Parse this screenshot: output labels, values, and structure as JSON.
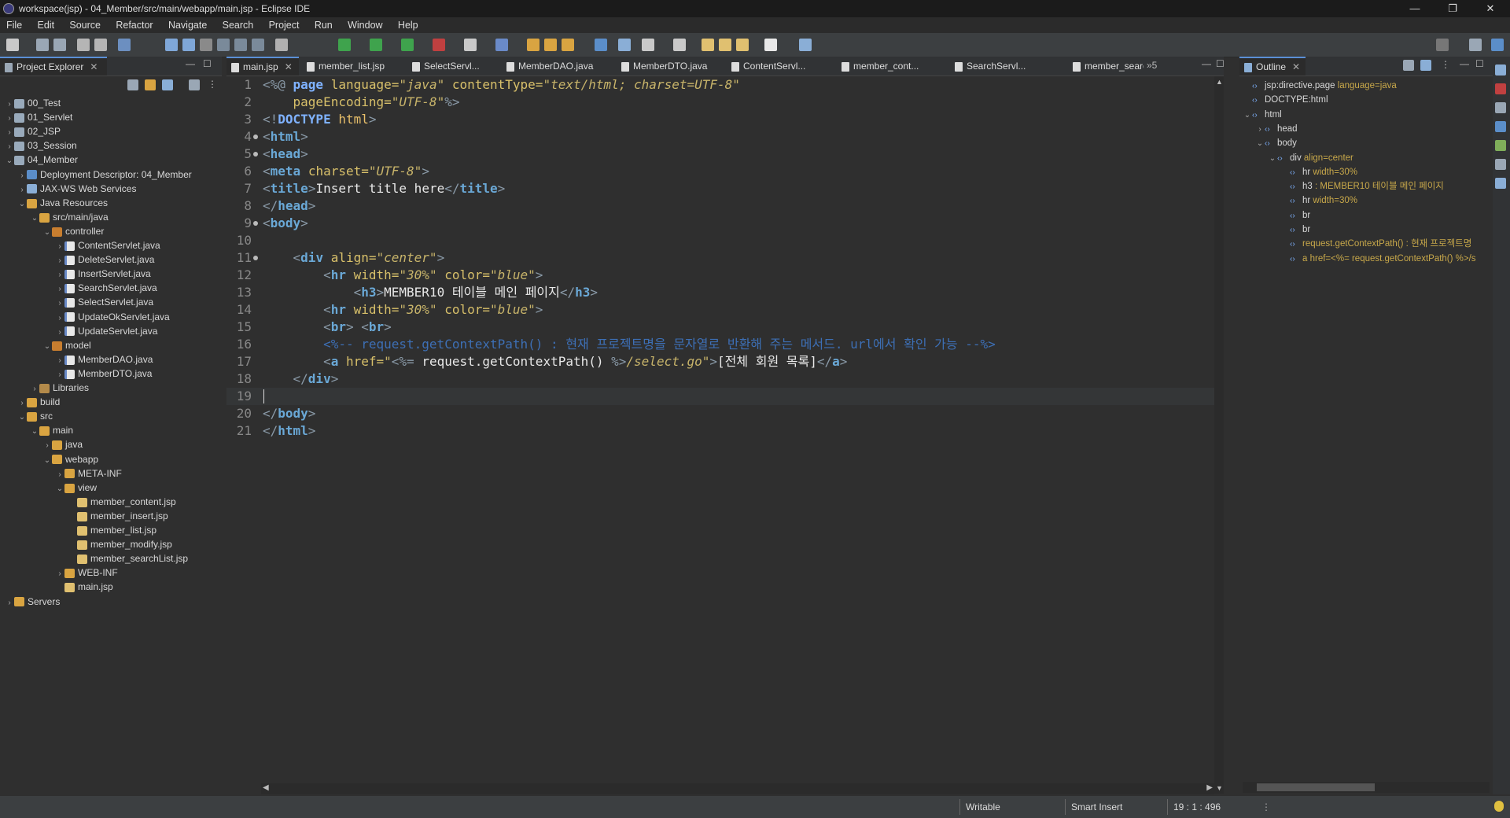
{
  "window": {
    "title": "workspace(jsp) - 04_Member/src/main/webapp/main.jsp - Eclipse IDE",
    "minimize": "—",
    "maximize": "❐",
    "close": "✕"
  },
  "menu": [
    "File",
    "Edit",
    "Source",
    "Refactor",
    "Navigate",
    "Search",
    "Project",
    "Run",
    "Window",
    "Help"
  ],
  "project_explorer": {
    "tab_label": "Project Explorer",
    "tree": [
      {
        "label": "00_Test",
        "indent": 0,
        "icon": "proj",
        "twisty": ">"
      },
      {
        "label": "01_Servlet",
        "indent": 0,
        "icon": "proj",
        "twisty": ">"
      },
      {
        "label": "02_JSP",
        "indent": 0,
        "icon": "proj",
        "twisty": ">"
      },
      {
        "label": "03_Session",
        "indent": 0,
        "icon": "proj",
        "twisty": ">"
      },
      {
        "label": "04_Member",
        "indent": 0,
        "icon": "proj",
        "twisty": "v"
      },
      {
        "label": "Deployment Descriptor: 04_Member",
        "indent": 1,
        "icon": "dd",
        "twisty": ">"
      },
      {
        "label": "JAX-WS Web Services",
        "indent": 1,
        "icon": "ws",
        "twisty": ">"
      },
      {
        "label": "Java Resources",
        "indent": 1,
        "icon": "folder",
        "twisty": "v"
      },
      {
        "label": "src/main/java",
        "indent": 2,
        "icon": "folder",
        "twisty": "v"
      },
      {
        "label": "controller",
        "indent": 3,
        "icon": "pkg",
        "twisty": "v"
      },
      {
        "label": "ContentServlet.java",
        "indent": 4,
        "icon": "java",
        "twisty": ">"
      },
      {
        "label": "DeleteServlet.java",
        "indent": 4,
        "icon": "java",
        "twisty": ">"
      },
      {
        "label": "InsertServlet.java",
        "indent": 4,
        "icon": "java",
        "twisty": ">"
      },
      {
        "label": "SearchServlet.java",
        "indent": 4,
        "icon": "java",
        "twisty": ">"
      },
      {
        "label": "SelectServlet.java",
        "indent": 4,
        "icon": "java",
        "twisty": ">"
      },
      {
        "label": "UpdateOkServlet.java",
        "indent": 4,
        "icon": "java",
        "twisty": ">"
      },
      {
        "label": "UpdateServlet.java",
        "indent": 4,
        "icon": "java",
        "twisty": ">"
      },
      {
        "label": "model",
        "indent": 3,
        "icon": "pkg",
        "twisty": "v"
      },
      {
        "label": "MemberDAO.java",
        "indent": 4,
        "icon": "java",
        "twisty": ">"
      },
      {
        "label": "MemberDTO.java",
        "indent": 4,
        "icon": "java",
        "twisty": ">"
      },
      {
        "label": "Libraries",
        "indent": 2,
        "icon": "lib",
        "twisty": ">"
      },
      {
        "label": "build",
        "indent": 1,
        "icon": "folder",
        "twisty": ">"
      },
      {
        "label": "src",
        "indent": 1,
        "icon": "folder",
        "twisty": "v"
      },
      {
        "label": "main",
        "indent": 2,
        "icon": "folder",
        "twisty": "v"
      },
      {
        "label": "java",
        "indent": 3,
        "icon": "folder",
        "twisty": ">"
      },
      {
        "label": "webapp",
        "indent": 3,
        "icon": "folder",
        "twisty": "v"
      },
      {
        "label": "META-INF",
        "indent": 4,
        "icon": "folder",
        "twisty": ">"
      },
      {
        "label": "view",
        "indent": 4,
        "icon": "folder",
        "twisty": "v"
      },
      {
        "label": "member_content.jsp",
        "indent": 5,
        "icon": "jsp",
        "twisty": ""
      },
      {
        "label": "member_insert.jsp",
        "indent": 5,
        "icon": "jsp",
        "twisty": ""
      },
      {
        "label": "member_list.jsp",
        "indent": 5,
        "icon": "jsp",
        "twisty": ""
      },
      {
        "label": "member_modify.jsp",
        "indent": 5,
        "icon": "jsp",
        "twisty": ""
      },
      {
        "label": "member_searchList.jsp",
        "indent": 5,
        "icon": "jsp",
        "twisty": ""
      },
      {
        "label": "WEB-INF",
        "indent": 4,
        "icon": "folder",
        "twisty": ">"
      },
      {
        "label": "main.jsp",
        "indent": 4,
        "icon": "jsp",
        "twisty": ""
      },
      {
        "label": "Servers",
        "indent": 0,
        "icon": "folder",
        "twisty": ">"
      }
    ]
  },
  "editor_tabs": [
    {
      "label": "main.jsp",
      "active": true
    },
    {
      "label": "member_list.jsp",
      "active": false
    },
    {
      "label": "SelectServl...",
      "active": false
    },
    {
      "label": "MemberDAO.java",
      "active": false
    },
    {
      "label": "MemberDTO.java",
      "active": false
    },
    {
      "label": "ContentServl...",
      "active": false
    },
    {
      "label": "member_cont...",
      "active": false
    },
    {
      "label": "SearchServl...",
      "active": false
    },
    {
      "label": "member_searc...",
      "active": false
    }
  ],
  "more_tabs": "»5",
  "code_lines": [
    [
      [
        "k-br",
        "<%@ "
      ],
      [
        "k-kw",
        "page "
      ],
      [
        "k-attr",
        "language="
      ],
      [
        "k-str",
        "\"java\" "
      ],
      [
        "k-attr",
        "contentType="
      ],
      [
        "k-str",
        "\"text/html; charset=UTF-8\""
      ]
    ],
    [
      [
        "k-txt",
        "    "
      ],
      [
        "k-attr",
        "pageEncoding="
      ],
      [
        "k-str",
        "\"UTF-8\""
      ],
      [
        "k-br",
        "%>"
      ]
    ],
    [
      [
        "k-br",
        "<!"
      ],
      [
        "k-kw",
        "DOCTYPE "
      ],
      [
        "k-dir",
        "html"
      ],
      [
        "k-br",
        ">"
      ]
    ],
    [
      [
        "k-br",
        "<"
      ],
      [
        "k-tag",
        "html"
      ],
      [
        "k-br",
        ">"
      ]
    ],
    [
      [
        "k-br",
        "<"
      ],
      [
        "k-tag",
        "head"
      ],
      [
        "k-br",
        ">"
      ]
    ],
    [
      [
        "k-br",
        "<"
      ],
      [
        "k-tag",
        "meta "
      ],
      [
        "k-attr",
        "charset="
      ],
      [
        "k-str",
        "\"UTF-8\""
      ],
      [
        "k-br",
        ">"
      ]
    ],
    [
      [
        "k-br",
        "<"
      ],
      [
        "k-tag",
        "title"
      ],
      [
        "k-br",
        ">"
      ],
      [
        "k-txt",
        "Insert title here"
      ],
      [
        "k-br",
        "</"
      ],
      [
        "k-tag",
        "title"
      ],
      [
        "k-br",
        ">"
      ]
    ],
    [
      [
        "k-br",
        "</"
      ],
      [
        "k-tag",
        "head"
      ],
      [
        "k-br",
        ">"
      ]
    ],
    [
      [
        "k-br",
        "<"
      ],
      [
        "k-tag",
        "body"
      ],
      [
        "k-br",
        ">"
      ]
    ],
    [],
    [
      [
        "k-txt",
        "    "
      ],
      [
        "k-br",
        "<"
      ],
      [
        "k-tag",
        "div "
      ],
      [
        "k-attr",
        "align="
      ],
      [
        "k-str",
        "\"center\""
      ],
      [
        "k-br",
        ">"
      ]
    ],
    [
      [
        "k-txt",
        "        "
      ],
      [
        "k-br",
        "<"
      ],
      [
        "k-tag",
        "hr "
      ],
      [
        "k-attr",
        "width="
      ],
      [
        "k-str",
        "\"30%\" "
      ],
      [
        "k-attr",
        "color="
      ],
      [
        "k-str",
        "\"blue\""
      ],
      [
        "k-br",
        ">"
      ]
    ],
    [
      [
        "k-txt",
        "            "
      ],
      [
        "k-br",
        "<"
      ],
      [
        "k-tag",
        "h3"
      ],
      [
        "k-br",
        ">"
      ],
      [
        "k-txt",
        "MEMBER10 테이블 메인 페이지"
      ],
      [
        "k-br",
        "</"
      ],
      [
        "k-tag",
        "h3"
      ],
      [
        "k-br",
        ">"
      ]
    ],
    [
      [
        "k-txt",
        "        "
      ],
      [
        "k-br",
        "<"
      ],
      [
        "k-tag",
        "hr "
      ],
      [
        "k-attr",
        "width="
      ],
      [
        "k-str",
        "\"30%\" "
      ],
      [
        "k-attr",
        "color="
      ],
      [
        "k-str",
        "\"blue\""
      ],
      [
        "k-br",
        ">"
      ]
    ],
    [
      [
        "k-txt",
        "        "
      ],
      [
        "k-br",
        "<"
      ],
      [
        "k-tag",
        "br"
      ],
      [
        "k-br",
        "> <"
      ],
      [
        "k-tag",
        "br"
      ],
      [
        "k-br",
        ">"
      ]
    ],
    [
      [
        "k-txt",
        "        "
      ],
      [
        "k-cmt",
        "<%-- request.getContextPath() : 현재 프로젝트명을 문자열로 반환해 주는 메서드. url에서 확인 가능 --%>"
      ]
    ],
    [
      [
        "k-txt",
        "        "
      ],
      [
        "k-br",
        "<"
      ],
      [
        "k-tag",
        "a "
      ],
      [
        "k-attr",
        "href="
      ],
      [
        "k-str",
        "\""
      ],
      [
        "k-br",
        "<%= "
      ],
      [
        "k-txt",
        "request.getContextPath() "
      ],
      [
        "k-br",
        "%>"
      ],
      [
        "k-str",
        "/select.go\""
      ],
      [
        "k-br",
        ">"
      ],
      [
        "k-txt",
        "[전체 회원 목록]"
      ],
      [
        "k-br",
        "</"
      ],
      [
        "k-tag",
        "a"
      ],
      [
        "k-br",
        ">"
      ]
    ],
    [
      [
        "k-txt",
        "    "
      ],
      [
        "k-br",
        "</"
      ],
      [
        "k-tag",
        "div"
      ],
      [
        "k-br",
        ">"
      ]
    ],
    [],
    [
      [
        "k-br",
        "</"
      ],
      [
        "k-tag",
        "body"
      ],
      [
        "k-br",
        ">"
      ]
    ],
    [
      [
        "k-br",
        "</"
      ],
      [
        "k-tag",
        "html"
      ],
      [
        "k-br",
        ">"
      ]
    ]
  ],
  "fold_lines": [
    4,
    5,
    9,
    11
  ],
  "outline": {
    "tab_label": "Outline",
    "rows": [
      {
        "indent": 0,
        "twisty": "",
        "name": "jsp:directive.page",
        "attr": " language=java"
      },
      {
        "indent": 0,
        "twisty": "",
        "name": "DOCTYPE:html",
        "attr": ""
      },
      {
        "indent": 0,
        "twisty": "v",
        "name": "html",
        "attr": ""
      },
      {
        "indent": 1,
        "twisty": ">",
        "name": "head",
        "attr": ""
      },
      {
        "indent": 1,
        "twisty": "v",
        "name": "body",
        "attr": ""
      },
      {
        "indent": 2,
        "twisty": "v",
        "name": "div",
        "attr": " align=center"
      },
      {
        "indent": 3,
        "twisty": "",
        "name": "hr",
        "attr": " width=30%"
      },
      {
        "indent": 3,
        "twisty": "",
        "name": "h3",
        "attr": " : MEMBER10 테이블 메인 페이지"
      },
      {
        "indent": 3,
        "twisty": "",
        "name": "hr",
        "attr": " width=30%"
      },
      {
        "indent": 3,
        "twisty": "",
        "name": "br",
        "attr": ""
      },
      {
        "indent": 3,
        "twisty": "",
        "name": "br",
        "attr": ""
      },
      {
        "indent": 3,
        "twisty": "",
        "name": "",
        "attr": "request.getContextPath() : 현재 프로젝트명"
      },
      {
        "indent": 3,
        "twisty": "",
        "name": "",
        "attr": "a href=<%= request.getContextPath() %>/s"
      }
    ]
  },
  "status": {
    "writable": "Writable",
    "insert_mode": "Smart Insert",
    "position": "19 : 1 : 496"
  }
}
